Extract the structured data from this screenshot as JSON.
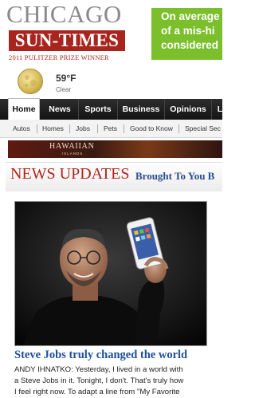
{
  "masthead": {
    "city": "CHICAGO",
    "paper": "SUN-TIMES",
    "award": "2011 PULITZER PRIZE WINNER"
  },
  "top_ad": {
    "lines": [
      "On average",
      "of a mis-hi",
      "considered"
    ],
    "background": "#7cbf2c"
  },
  "weather": {
    "temperature": "59°F",
    "condition": "Clear",
    "icon": "moon-icon"
  },
  "nav": {
    "tabs": [
      {
        "label": "Home",
        "active": true
      },
      {
        "label": "News",
        "active": false
      },
      {
        "label": "Sports",
        "active": false
      },
      {
        "label": "Business",
        "active": false
      },
      {
        "label": "Opinions",
        "active": false
      },
      {
        "label": "L",
        "active": false
      }
    ]
  },
  "subnav": {
    "items": [
      "Autos",
      "Homes",
      "Jobs",
      "Pets",
      "Good to Know",
      "Special Sec"
    ]
  },
  "banner_ad": {
    "brand": "HAWAIIAN",
    "tagline": "ISLANDS"
  },
  "news_updates": {
    "title": "NEWS UPDATES",
    "subtitle": "Brought To You B"
  },
  "story": {
    "headline": "Steve Jobs truly changed the world",
    "lines": [
      "ANDY IHNATKO: Yesterday, I lived in a world with",
      "a Steve Jobs in it. Tonight, I don't. That's truly how",
      "I feel right now. To adapt a line from \"My Favorite"
    ]
  },
  "colors": {
    "brand_red": "#a8251f",
    "link_blue": "#1d4f9a",
    "nav_dark": "#1e1e1e"
  }
}
